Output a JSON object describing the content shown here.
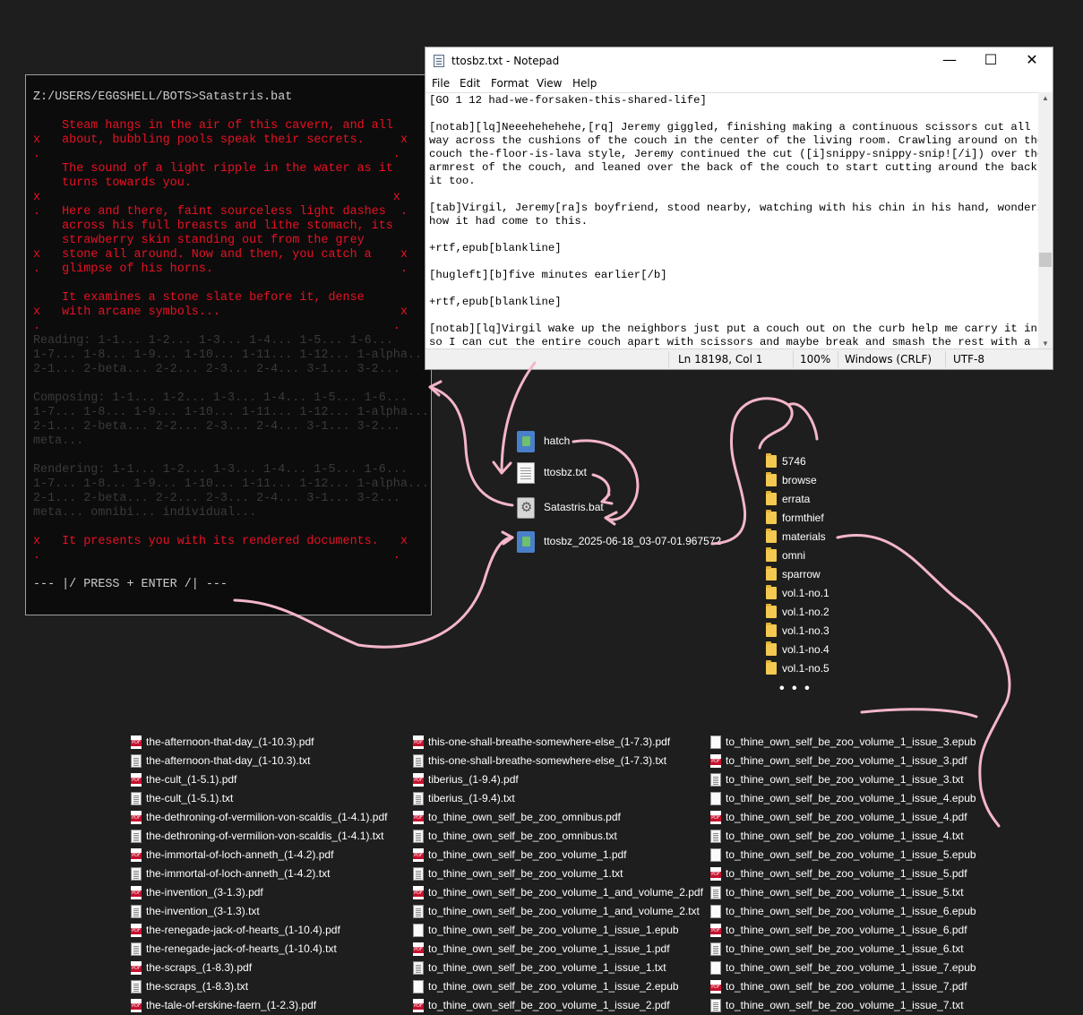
{
  "console": {
    "prompt": "Z:/USERS/EGGSHELL/BOTS>Satastris.bat",
    "lines": [
      {
        "text": "    Steam hangs in the air of this cavern, and all",
        "cls": "c-red"
      },
      {
        "text": "x   about, bubbling pools speak their secrets.     x",
        "cls": "c-red"
      },
      {
        "text": ".                                                 .",
        "cls": "c-red"
      },
      {
        "text": "    The sound of a light ripple in the water as it",
        "cls": "c-red"
      },
      {
        "text": "    turns towards you.",
        "cls": "c-red"
      },
      {
        "text": "x                                                 x",
        "cls": "c-red"
      },
      {
        "text": ".   Here and there, faint sourceless light dashes  .",
        "cls": "c-red"
      },
      {
        "text": "    across his full breasts and lithe stomach, its",
        "cls": "c-red"
      },
      {
        "text": "    strawberry skin standing out from the grey",
        "cls": "c-red"
      },
      {
        "text": "x   stone all around. Now and then, you catch a    x",
        "cls": "c-red"
      },
      {
        "text": ".   glimpse of his horns.                          .",
        "cls": "c-red"
      },
      {
        "text": "",
        "cls": "c-red"
      },
      {
        "text": "    It examines a stone slate before it, dense",
        "cls": "c-red"
      },
      {
        "text": "x   with arcane symbols...                         x",
        "cls": "c-red"
      },
      {
        "text": ".                                                 .",
        "cls": "c-red"
      },
      {
        "text": "Reading: 1-1... 1-2... 1-3... 1-4... 1-5... 1-6...",
        "cls": "c-gray"
      },
      {
        "text": "1-7... 1-8... 1-9... 1-10... 1-11... 1-12... 1-alpha...",
        "cls": "c-gray"
      },
      {
        "text": "2-1... 2-beta... 2-2... 2-3... 2-4... 3-1... 3-2...",
        "cls": "c-gray"
      },
      {
        "text": "",
        "cls": "c-gray"
      },
      {
        "text": "Composing: 1-1... 1-2... 1-3... 1-4... 1-5... 1-6...",
        "cls": "c-gray"
      },
      {
        "text": "1-7... 1-8... 1-9... 1-10... 1-11... 1-12... 1-alpha...",
        "cls": "c-gray"
      },
      {
        "text": "2-1... 2-beta... 2-2... 2-3... 2-4... 3-1... 3-2...",
        "cls": "c-gray"
      },
      {
        "text": "meta...",
        "cls": "c-gray"
      },
      {
        "text": "",
        "cls": "c-gray"
      },
      {
        "text": "Rendering: 1-1... 1-2... 1-3... 1-4... 1-5... 1-6...",
        "cls": "c-gray"
      },
      {
        "text": "1-7... 1-8... 1-9... 1-10... 1-11... 1-12... 1-alpha...",
        "cls": "c-gray"
      },
      {
        "text": "2-1... 2-beta... 2-2... 2-3... 2-4... 3-1... 3-2...",
        "cls": "c-gray"
      },
      {
        "text": "meta... omnibi... individual...",
        "cls": "c-gray"
      },
      {
        "text": "",
        "cls": "c-gray"
      },
      {
        "text": "x   It presents you with its rendered documents.   x",
        "cls": "c-red"
      },
      {
        "text": ".                                                 .",
        "cls": "c-red"
      },
      {
        "text": "",
        "cls": "c-red"
      },
      {
        "text": "--- |/ PRESS + ENTER /| ---",
        "cls": "c-press"
      }
    ]
  },
  "notepad": {
    "title": "ttosbz.txt - Notepad",
    "controls": {
      "minimize": "—",
      "maximize": "☐",
      "close": "✕"
    },
    "menu": [
      "File",
      "Edit",
      "Format",
      "View",
      "Help"
    ],
    "text_lines": [
      "[GO 1 12 had-we-forsaken-this-shared-life]",
      "",
      "[notab][lq]Neeehehehehe,[rq] Jeremy giggled, finishing making a continuous scissors cut all the",
      "way across the cushions of the couch in the center of the living room. Crawling around on the",
      "couch the-floor-is-lava style, Jeremy continued the cut ([i]snippy-snippy-snip![/i]) over the",
      "armrest of the couch, and leaned over the back of the couch to start cutting around the back of",
      "it too.",
      "",
      "[tab]Virgil, Jeremy[ra]s boyfriend, stood nearby, watching with his chin in his hand, wondering",
      "how it had come to this.",
      "",
      "+rtf,epub[blankline]",
      "",
      "[hugleft][b]five minutes earlier[/b]",
      "",
      "+rtf,epub[blankline]",
      "",
      "[notab][lq]Virgil wake up the neighbors just put a couch out on the curb help me carry it inside",
      "so I can cut the entire couch apart with scissors and maybe break and smash the rest with a"
    ],
    "status": {
      "position": "Ln 18198, Col 1",
      "zoom": "100%",
      "line_ending": "Windows (CRLF)",
      "encoding": "UTF-8"
    }
  },
  "desktop_files": [
    {
      "name": "hatch",
      "icon": "exe-icon"
    },
    {
      "name": "ttosbz.txt",
      "icon": "txt-icon"
    },
    {
      "name": "Satastris.bat",
      "icon": "bat-icon"
    },
    {
      "name": "ttosbz_2025-06-18_03-07-01.967572",
      "icon": "exe-icon"
    }
  ],
  "folders": [
    "5746",
    "browse",
    "errata",
    "formthief",
    "materials",
    "omni",
    "sparrow",
    "vol.1-no.1",
    "vol.1-no.2",
    "vol.1-no.3",
    "vol.1-no.4",
    "vol.1-no.5"
  ],
  "folders_more": "• • •",
  "file_columns": [
    [
      {
        "name": "the-afternoon-that-day_(1-10.3).pdf",
        "type": "pdf"
      },
      {
        "name": "the-afternoon-that-day_(1-10.3).txt",
        "type": "txt"
      },
      {
        "name": "the-cult_(1-5.1).pdf",
        "type": "pdf"
      },
      {
        "name": "the-cult_(1-5.1).txt",
        "type": "txt"
      },
      {
        "name": "the-dethroning-of-vermilion-von-scaldis_(1-4.1).pdf",
        "type": "pdf"
      },
      {
        "name": "the-dethroning-of-vermilion-von-scaldis_(1-4.1).txt",
        "type": "txt"
      },
      {
        "name": "the-immortal-of-loch-anneth_(1-4.2).pdf",
        "type": "pdf"
      },
      {
        "name": "the-immortal-of-loch-anneth_(1-4.2).txt",
        "type": "txt"
      },
      {
        "name": "the-invention_(3-1.3).pdf",
        "type": "pdf"
      },
      {
        "name": "the-invention_(3-1.3).txt",
        "type": "txt"
      },
      {
        "name": "the-renegade-jack-of-hearts_(1-10.4).pdf",
        "type": "pdf"
      },
      {
        "name": "the-renegade-jack-of-hearts_(1-10.4).txt",
        "type": "txt"
      },
      {
        "name": "the-scraps_(1-8.3).pdf",
        "type": "pdf"
      },
      {
        "name": "the-scraps_(1-8.3).txt",
        "type": "txt"
      },
      {
        "name": "the-tale-of-erskine-faern_(1-2.3).pdf",
        "type": "pdf"
      }
    ],
    [
      {
        "name": "this-one-shall-breathe-somewhere-else_(1-7.3).pdf",
        "type": "pdf"
      },
      {
        "name": "this-one-shall-breathe-somewhere-else_(1-7.3).txt",
        "type": "txt"
      },
      {
        "name": "tiberius_(1-9.4).pdf",
        "type": "pdf"
      },
      {
        "name": "tiberius_(1-9.4).txt",
        "type": "txt"
      },
      {
        "name": "to_thine_own_self_be_zoo_omnibus.pdf",
        "type": "pdf"
      },
      {
        "name": "to_thine_own_self_be_zoo_omnibus.txt",
        "type": "txt"
      },
      {
        "name": "to_thine_own_self_be_zoo_volume_1.pdf",
        "type": "pdf"
      },
      {
        "name": "to_thine_own_self_be_zoo_volume_1.txt",
        "type": "txt"
      },
      {
        "name": "to_thine_own_self_be_zoo_volume_1_and_volume_2.pdf",
        "type": "pdf"
      },
      {
        "name": "to_thine_own_self_be_zoo_volume_1_and_volume_2.txt",
        "type": "txt"
      },
      {
        "name": "to_thine_own_self_be_zoo_volume_1_issue_1.epub",
        "type": "epub"
      },
      {
        "name": "to_thine_own_self_be_zoo_volume_1_issue_1.pdf",
        "type": "pdf"
      },
      {
        "name": "to_thine_own_self_be_zoo_volume_1_issue_1.txt",
        "type": "txt"
      },
      {
        "name": "to_thine_own_self_be_zoo_volume_1_issue_2.epub",
        "type": "epub"
      },
      {
        "name": "to_thine_own_self_be_zoo_volume_1_issue_2.pdf",
        "type": "pdf"
      }
    ],
    [
      {
        "name": "to_thine_own_self_be_zoo_volume_1_issue_3.epub",
        "type": "epub"
      },
      {
        "name": "to_thine_own_self_be_zoo_volume_1_issue_3.pdf",
        "type": "pdf"
      },
      {
        "name": "to_thine_own_self_be_zoo_volume_1_issue_3.txt",
        "type": "txt"
      },
      {
        "name": "to_thine_own_self_be_zoo_volume_1_issue_4.epub",
        "type": "epub"
      },
      {
        "name": "to_thine_own_self_be_zoo_volume_1_issue_4.pdf",
        "type": "pdf"
      },
      {
        "name": "to_thine_own_self_be_zoo_volume_1_issue_4.txt",
        "type": "txt"
      },
      {
        "name": "to_thine_own_self_be_zoo_volume_1_issue_5.epub",
        "type": "epub"
      },
      {
        "name": "to_thine_own_self_be_zoo_volume_1_issue_5.pdf",
        "type": "pdf"
      },
      {
        "name": "to_thine_own_self_be_zoo_volume_1_issue_5.txt",
        "type": "txt"
      },
      {
        "name": "to_thine_own_self_be_zoo_volume_1_issue_6.epub",
        "type": "epub"
      },
      {
        "name": "to_thine_own_self_be_zoo_volume_1_issue_6.pdf",
        "type": "pdf"
      },
      {
        "name": "to_thine_own_self_be_zoo_volume_1_issue_6.txt",
        "type": "txt"
      },
      {
        "name": "to_thine_own_self_be_zoo_volume_1_issue_7.epub",
        "type": "epub"
      },
      {
        "name": "to_thine_own_self_be_zoo_volume_1_issue_7.pdf",
        "type": "pdf"
      },
      {
        "name": "to_thine_own_self_be_zoo_volume_1_issue_7.txt",
        "type": "txt"
      }
    ]
  ],
  "colors": {
    "background": "#1e1e1e",
    "console_red": "#e81123",
    "console_gray": "#3a3a3a",
    "annotation_pink": "#f4b6c8"
  }
}
